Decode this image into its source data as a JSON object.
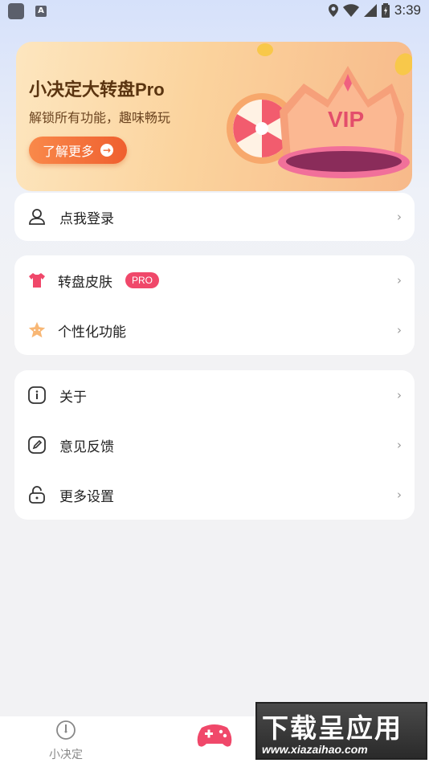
{
  "status_bar": {
    "time": "3:39"
  },
  "banner": {
    "title": "小决定大转盘Pro",
    "subtitle": "解锁所有功能，趣味畅玩",
    "button_label": "了解更多",
    "crown_text": "VIP"
  },
  "login": {
    "label": "点我登录"
  },
  "features": [
    {
      "label": "转盘皮肤",
      "badge": "PRO",
      "icon": "tshirt-icon"
    },
    {
      "label": "个性化功能",
      "icon": "star-icon"
    }
  ],
  "more": [
    {
      "label": "关于",
      "icon": "info-icon"
    },
    {
      "label": "意见反馈",
      "icon": "edit-icon"
    },
    {
      "label": "更多设置",
      "icon": "lock-icon"
    }
  ],
  "bottom_nav": {
    "tab1_label": "小决定"
  },
  "watermark": {
    "big": "下载呈应用",
    "small": "www.xiazaihao.com"
  },
  "colors": {
    "accent": "#f0486a",
    "banner_button": "#ef6a35",
    "banner_text": "#5a3410"
  }
}
